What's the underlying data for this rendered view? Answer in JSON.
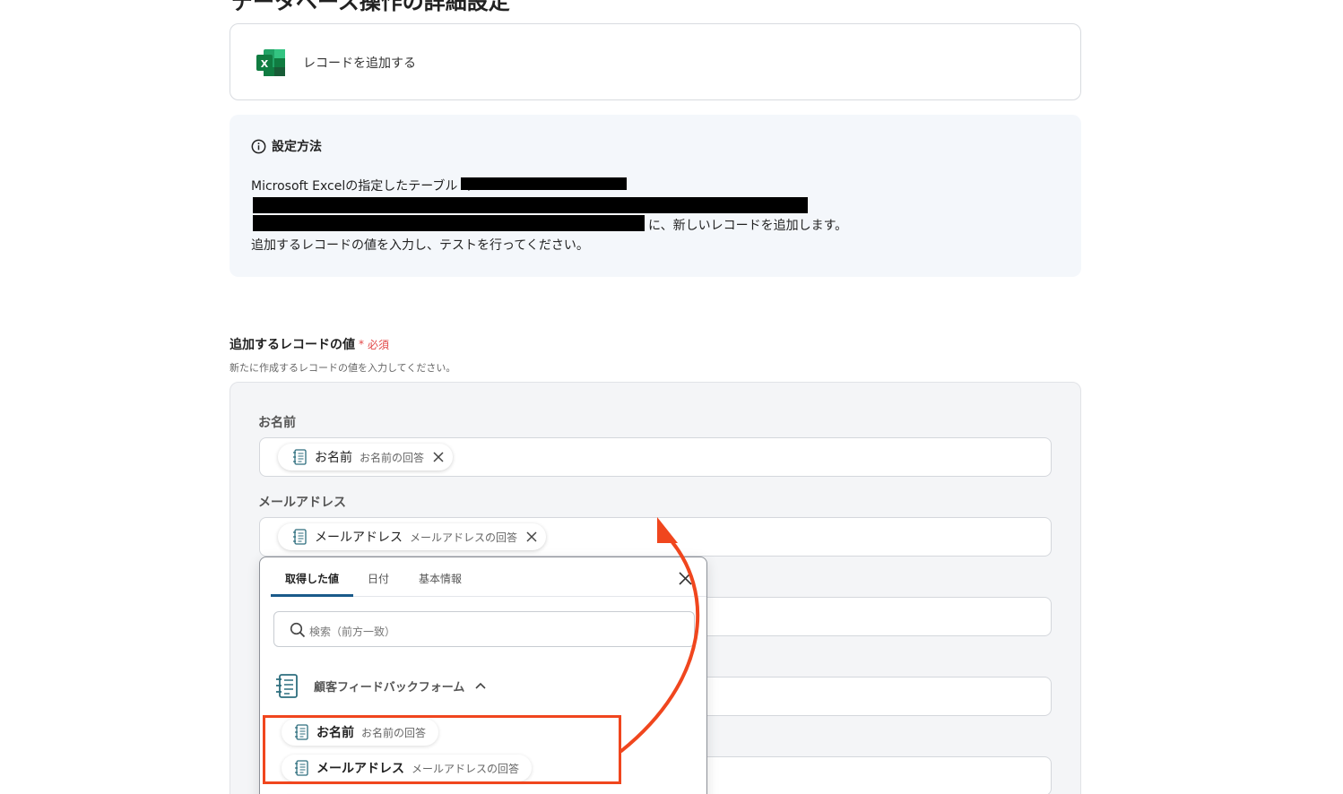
{
  "page": {
    "title": "データベース操作の詳細設定"
  },
  "action": {
    "label": "レコードを追加する",
    "app_icon": "excel-icon"
  },
  "info": {
    "title": "設定方法",
    "line1": "Microsoft Excelの指定したテーブル（",
    "line3_tail": "に、新しいレコードを追加します。",
    "line4": "追加するレコードの値を入力し、テストを行ってください。"
  },
  "field": {
    "title": "追加するレコードの値",
    "required_mark": "*",
    "required_label": "必須",
    "subtitle": "新たに作成するレコードの値を入力してください。"
  },
  "rows": [
    {
      "label": "お名前",
      "chip": {
        "name": "お名前",
        "desc": "お名前の回答"
      }
    },
    {
      "label": "メールアドレス",
      "chip": {
        "name": "メールアドレス",
        "desc": "メールアドレスの回答"
      }
    }
  ],
  "popup": {
    "tabs": [
      "取得した値",
      "日付",
      "基本情報"
    ],
    "active_tab": "取得した値",
    "search_placeholder": "検索（前方一致）",
    "group": {
      "name": "顧客フィードバックフォーム",
      "expanded": true
    },
    "items": [
      {
        "name": "お名前",
        "desc": "お名前の回答"
      },
      {
        "name": "メールアドレス",
        "desc": "メールアドレスの回答"
      }
    ]
  },
  "colors": {
    "annotation": "#f0461e",
    "accent_tab": "#1a5a8a",
    "required": "#e24646"
  }
}
